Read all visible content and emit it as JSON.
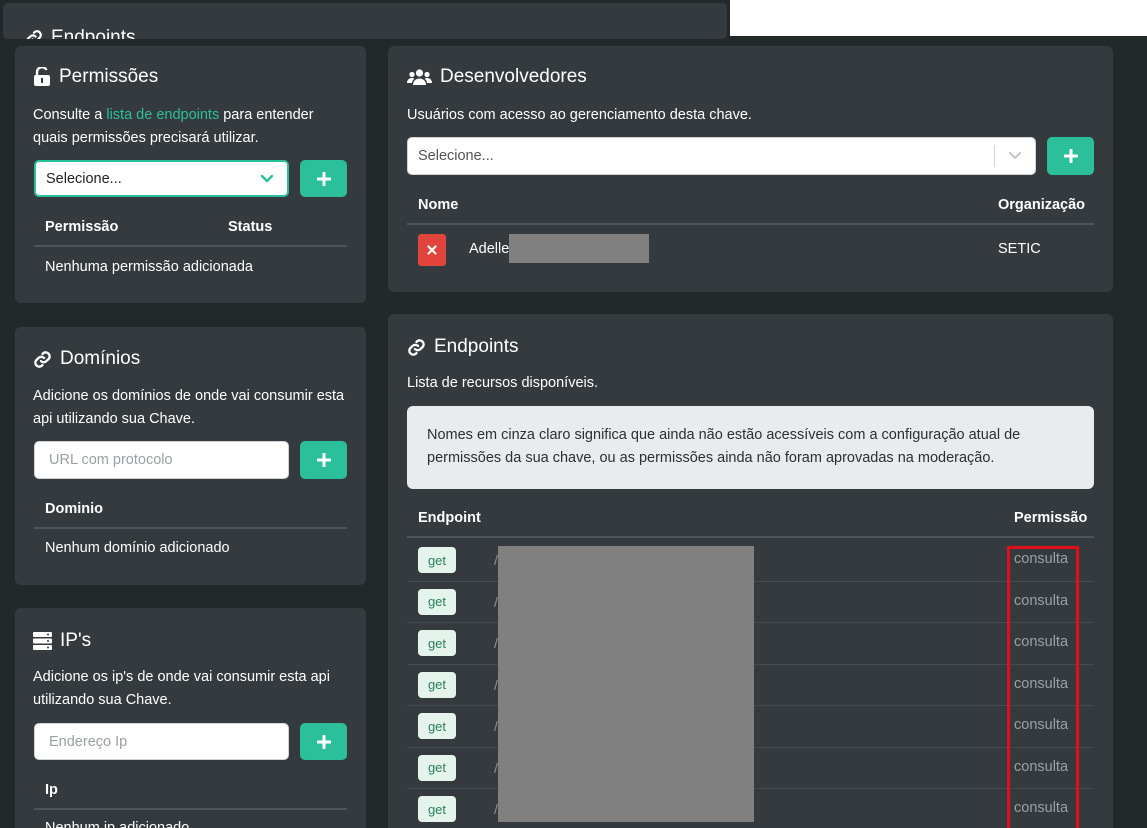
{
  "top_card": {
    "title": "Endpoints",
    "icon": "link-icon"
  },
  "permissoes": {
    "title": "Permissões",
    "icon": "unlock-icon",
    "desc_before": "Consulte a ",
    "desc_link": "lista de endpoints",
    "desc_after_line1": " para entender",
    "desc_line2": "quais permissões precisará utilizar.",
    "select_placeholder": "Selecione...",
    "add_label": "+",
    "columns": [
      "Permissão",
      "Status"
    ],
    "empty": "Nenhuma permissão adicionada"
  },
  "dominios": {
    "title": "Domínios",
    "icon": "link-icon",
    "desc_line1": "Adicione os domínios de onde vai consumir esta",
    "desc_line2": "api utilizando sua Chave.",
    "input_placeholder": "URL com protocolo",
    "add_label": "+",
    "column": "Dominio",
    "empty": "Nenhum domínio adicionado"
  },
  "ips": {
    "title": "IP's",
    "icon": "server-icon",
    "desc_line1": "Adicione os ip's de onde vai consumir esta api",
    "desc_line2": "utilizando sua Chave.",
    "input_placeholder": "Endereço Ip",
    "add_label": "+",
    "column": "Ip",
    "empty": "Nenhum ip adicionado"
  },
  "desenvolvedores": {
    "title": "Desenvolvedores",
    "icon": "users-icon",
    "desc": "Usuários com acesso ao gerenciamento desta chave.",
    "select_placeholder": "Selecione...",
    "add_label": "+",
    "columns": [
      "Nome",
      "Organização"
    ],
    "rows": [
      {
        "name": "Adelle",
        "org": "SETIC"
      }
    ]
  },
  "endpoints": {
    "title": "Endpoints",
    "icon": "link-icon",
    "desc": "Lista de recursos disponíveis.",
    "info_line1": "Nomes em cinza claro significa que ainda não estão acessíveis com a configuração atual de",
    "info_line2": "permissões da sua chave, ou as permissões ainda não foram aprovadas na moderação.",
    "columns": [
      "Endpoint",
      "Permissão"
    ],
    "rows": [
      {
        "method": "get",
        "path": "/",
        "permission": "consulta"
      },
      {
        "method": "get",
        "path": "/",
        "permission": "consulta"
      },
      {
        "method": "get",
        "path": "/",
        "permission": "consulta"
      },
      {
        "method": "get",
        "path": "/",
        "permission": "consulta"
      },
      {
        "method": "get",
        "path": "/",
        "permission": "consulta"
      },
      {
        "method": "get",
        "path": "/",
        "permission": "consulta"
      },
      {
        "method": "get",
        "path": "/",
        "permission": "consulta"
      }
    ]
  },
  "colors": {
    "accent": "#2bbf9a",
    "danger": "#e0443a",
    "card": "#343a3d",
    "background": "#23282b",
    "highlight": "#e0101a"
  }
}
